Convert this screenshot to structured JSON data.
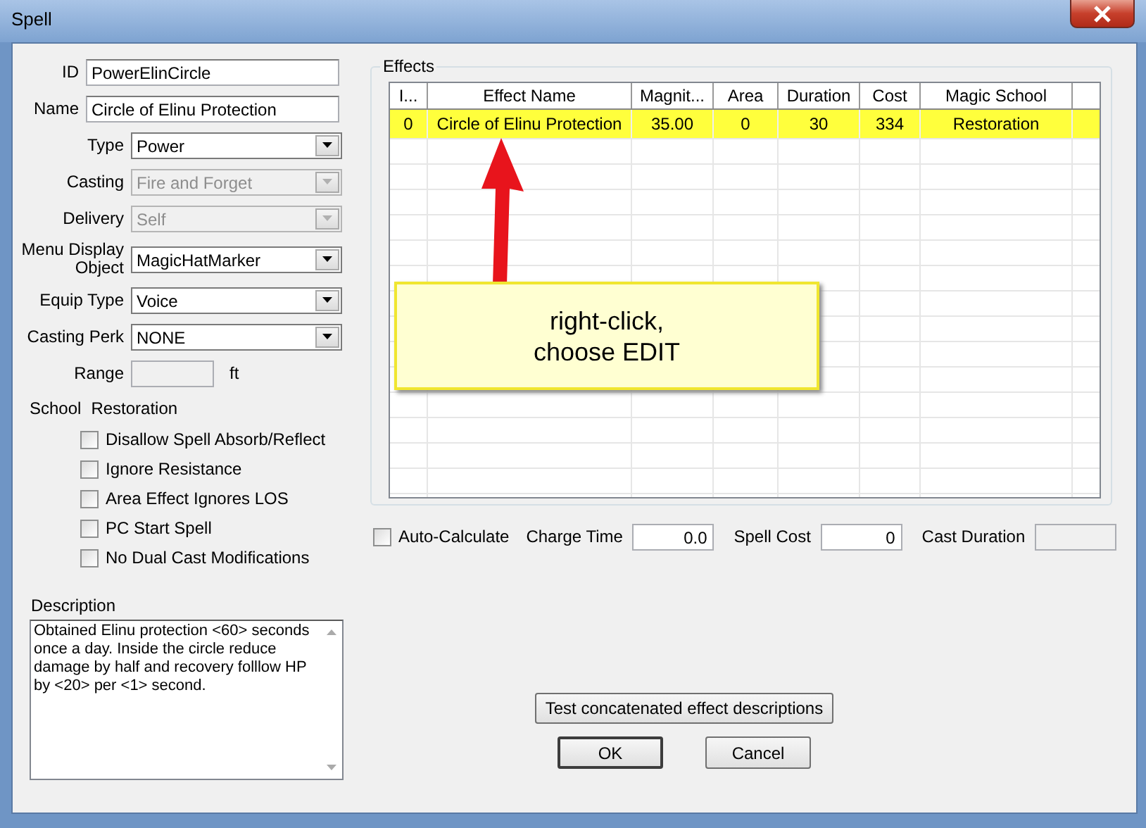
{
  "window": {
    "title": "Spell"
  },
  "fields": [
    {
      "kind": "text",
      "label": "ID",
      "value": "PowerElinCircle"
    },
    {
      "kind": "text",
      "label": "Name",
      "value": "Circle of Elinu Protection"
    },
    {
      "kind": "dropdown",
      "label": "Type",
      "value": "Power",
      "disabled": false
    },
    {
      "kind": "dropdown",
      "label": "Casting",
      "value": "Fire and Forget",
      "disabled": true
    },
    {
      "kind": "dropdown",
      "label": "Delivery",
      "value": "Self",
      "disabled": true
    },
    {
      "kind": "dropdown",
      "label": "Menu Display Object",
      "value": "MagicHatMarker",
      "disabled": false
    },
    {
      "kind": "dropdown",
      "label": "Equip Type",
      "value": "Voice",
      "disabled": false
    },
    {
      "kind": "dropdown",
      "label": "Casting Perk",
      "value": "NONE",
      "disabled": false
    },
    {
      "kind": "number",
      "label": "Range",
      "unit": "ft",
      "disabled": true
    }
  ],
  "school": {
    "label": "School",
    "value": "Restoration"
  },
  "flags": [
    {
      "label": "Disallow Spell Absorb/Reflect",
      "checked": false
    },
    {
      "label": "Ignore Resistance",
      "checked": false
    },
    {
      "label": "Area Effect Ignores LOS",
      "checked": false
    },
    {
      "label": "PC Start Spell",
      "checked": false
    },
    {
      "label": "No Dual Cast Modifications",
      "checked": false
    }
  ],
  "description": {
    "label": "Description",
    "text": "Obtained Elinu protection <60> seconds once a day. Inside the circle reduce damage by half and recovery folllow HP by <20> per <1> second."
  },
  "effects": {
    "title": "Effects",
    "columns": [
      "I...",
      "Effect Name",
      "Magnit...",
      "Area",
      "Duration",
      "Cost",
      "Magic School"
    ],
    "rows": [
      {
        "cells": [
          "0",
          "Circle of Elinu Protection",
          "35.00",
          "0",
          "30",
          "334",
          "Restoration"
        ],
        "highlighted": true
      }
    ]
  },
  "options": {
    "auto_calculate": {
      "label": "Auto-Calculate",
      "checked": false
    },
    "fields": [
      {
        "label": "Charge Time",
        "value": "0.0",
        "disabled": false
      },
      {
        "label": "Spell Cost",
        "value": "0",
        "disabled": false
      },
      {
        "label": "Cast Duration",
        "disabled": true
      }
    ]
  },
  "buttons": [
    {
      "label": "Test concatenated effect descriptions",
      "kind": "wide"
    },
    {
      "label": "OK",
      "kind": "default"
    },
    {
      "label": "Cancel",
      "kind": "normal"
    }
  ],
  "callout": {
    "text": "right-click,\nchoose EDIT"
  }
}
